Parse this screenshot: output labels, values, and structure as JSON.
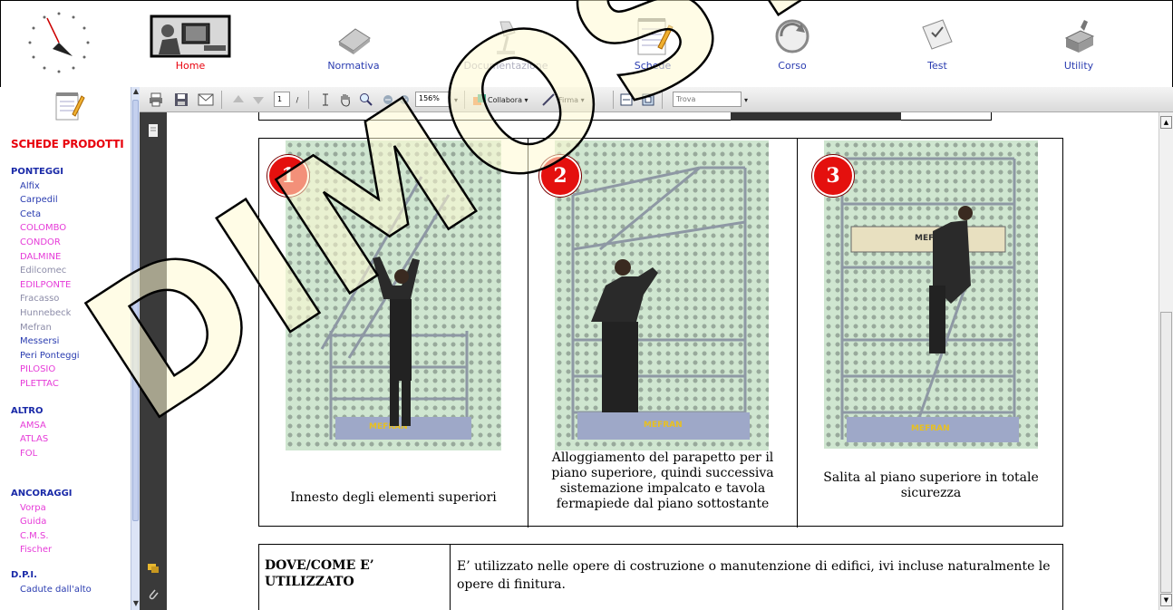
{
  "nav": {
    "items": [
      {
        "label": "Home",
        "color": "#e8000c"
      },
      {
        "label": "Normativa",
        "color": "#2a3cb0"
      },
      {
        "label": "Documentazione",
        "color": "#b0b0c0"
      },
      {
        "label": "Schede",
        "color": "#2a3cb0"
      },
      {
        "label": "Corso",
        "color": "#2a3cb0"
      },
      {
        "label": "Test",
        "color": "#2a3cb0"
      },
      {
        "label": "Utility",
        "color": "#2a3cb0"
      }
    ]
  },
  "sidebar": {
    "title": "SCHEDE PRODOTTI",
    "groups": [
      {
        "heading": "PONTEGGI",
        "items": [
          {
            "label": "Alfix",
            "color": "blue"
          },
          {
            "label": "Carpedil",
            "color": "blue"
          },
          {
            "label": "Ceta",
            "color": "blue"
          },
          {
            "label": "COLOMBO",
            "color": "pink"
          },
          {
            "label": "CONDOR",
            "color": "pink"
          },
          {
            "label": "DALMINE",
            "color": "pink"
          },
          {
            "label": "Edilcomec",
            "color": "grey"
          },
          {
            "label": "EDILPONTE",
            "color": "pink"
          },
          {
            "label": "Fracasso",
            "color": "grey"
          },
          {
            "label": "Hunnebeck",
            "color": "grey"
          },
          {
            "label": "Mefran",
            "color": "grey"
          },
          {
            "label": "Messersi",
            "color": "blue"
          },
          {
            "label": "Peri Ponteggi",
            "color": "blue"
          },
          {
            "label": "PILOSIO",
            "color": "pink"
          },
          {
            "label": "PLETTAC",
            "color": "pink"
          }
        ]
      },
      {
        "heading": "ALTRO",
        "items": [
          {
            "label": "AMSA",
            "color": "pink"
          },
          {
            "label": "ATLAS",
            "color": "pink"
          },
          {
            "label": "FOL",
            "color": "pink"
          }
        ]
      },
      {
        "heading": "ANCORAGGI",
        "items": [
          {
            "label": "Vorpa",
            "color": "pink"
          },
          {
            "label": "Guida",
            "color": "pink"
          },
          {
            "label": "C.M.S.",
            "color": "pink"
          },
          {
            "label": "Fischer",
            "color": "pink"
          }
        ]
      },
      {
        "heading": "D.P.I.",
        "items": [
          {
            "label": "Cadute dall'alto",
            "color": "blue"
          }
        ]
      }
    ]
  },
  "toolbar": {
    "page_number": "1",
    "page_sep": "/",
    "zoom": "156%",
    "collabora": "Collabora",
    "firma": "Firma",
    "search_placeholder": "Trova"
  },
  "document": {
    "steps": [
      {
        "number": "1",
        "caption": "Innesto degli elementi superiori"
      },
      {
        "number": "2",
        "caption": "Alloggiamento del parapetto per il piano superiore, quindi successiva sistemazione impalcato e tavola fermapiede dal piano sottostante"
      },
      {
        "number": "3",
        "caption": "Salita al piano superiore in totale sicurezza"
      }
    ],
    "usage_label": "DOVE/COME E’ UTILIZZATO",
    "usage_text": "E’ utilizzato nelle opere di costruzione o manutenzione di edifici, ivi incluse naturalmente le opere di finitura.",
    "scaffold_brand": "MEFRAN"
  },
  "watermark": {
    "text": "DIMOSTRATIVO"
  }
}
